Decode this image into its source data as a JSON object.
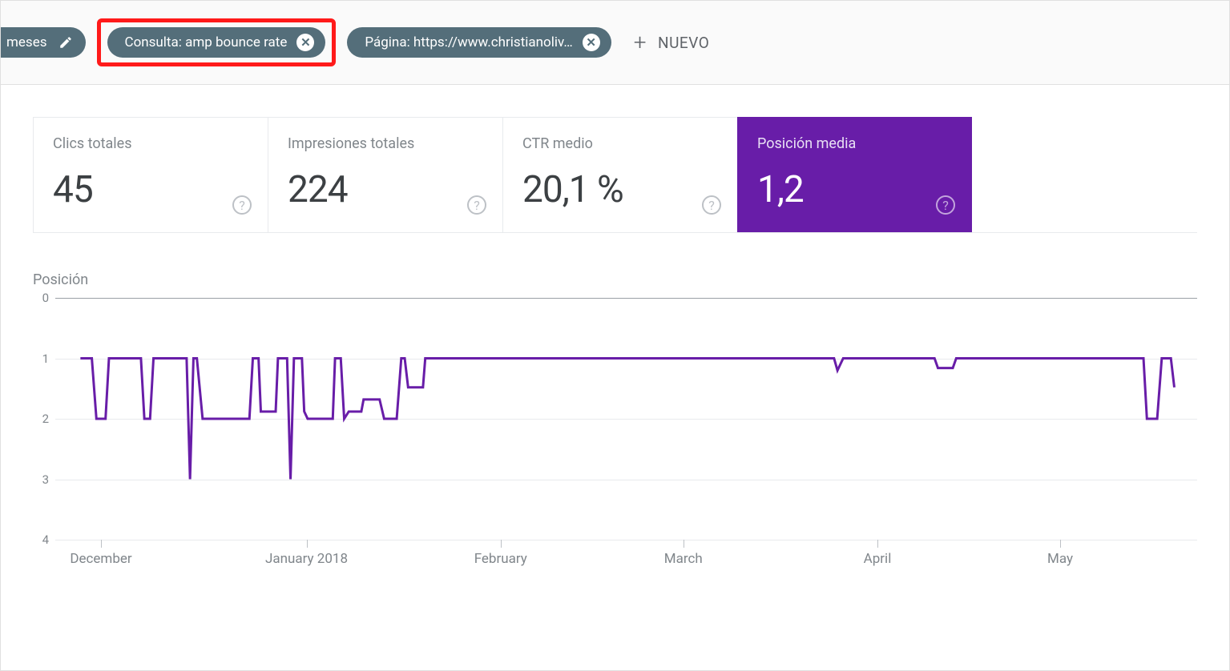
{
  "filters": {
    "date_chip": {
      "label": "meses",
      "icon": "edit"
    },
    "query_chip": {
      "label": "Consulta: amp bounce rate"
    },
    "page_chip": {
      "label": "Página: https://www.christianoliv…"
    },
    "new_label": "NUEVO"
  },
  "metrics": [
    {
      "label": "Clics totales",
      "value": "45",
      "active": false
    },
    {
      "label": "Impresiones totales",
      "value": "224",
      "active": false
    },
    {
      "label": "CTR medio",
      "value": "20,1 %",
      "active": false
    },
    {
      "label": "Posición media",
      "value": "1,2",
      "active": true
    }
  ],
  "chart_data": {
    "type": "line",
    "title": "Posición",
    "ylabel": "",
    "ylim": [
      4,
      0
    ],
    "yticks": [
      0,
      1,
      2,
      3,
      4
    ],
    "x_categories": [
      "December",
      "January 2018",
      "February",
      "March",
      "April",
      "May"
    ],
    "x_positions_pct": [
      4,
      22,
      39,
      55,
      72,
      88
    ],
    "series": [
      {
        "name": "Posición media",
        "points_pct": [
          [
            2.2,
            25
          ],
          [
            3.2,
            25
          ],
          [
            3.6,
            50
          ],
          [
            4.4,
            50
          ],
          [
            4.7,
            25
          ],
          [
            7.5,
            25
          ],
          [
            7.8,
            50
          ],
          [
            8.3,
            50
          ],
          [
            8.6,
            25
          ],
          [
            11.5,
            25
          ],
          [
            11.8,
            75
          ],
          [
            12.1,
            25
          ],
          [
            12.4,
            25
          ],
          [
            12.9,
            50
          ],
          [
            17.0,
            50
          ],
          [
            17.3,
            25
          ],
          [
            17.8,
            25
          ],
          [
            18.0,
            47
          ],
          [
            19.3,
            47
          ],
          [
            19.5,
            25
          ],
          [
            20.3,
            25
          ],
          [
            20.6,
            75
          ],
          [
            20.9,
            25
          ],
          [
            21.6,
            25
          ],
          [
            21.8,
            47
          ],
          [
            22.1,
            50
          ],
          [
            24.3,
            50
          ],
          [
            24.5,
            25
          ],
          [
            25.0,
            25
          ],
          [
            25.3,
            50
          ],
          [
            25.7,
            47
          ],
          [
            26.8,
            47
          ],
          [
            27.0,
            42
          ],
          [
            28.4,
            42
          ],
          [
            28.8,
            50
          ],
          [
            29.9,
            50
          ],
          [
            30.3,
            25
          ],
          [
            30.6,
            25
          ],
          [
            30.9,
            37
          ],
          [
            32.2,
            37
          ],
          [
            32.4,
            25
          ],
          [
            68.2,
            25
          ],
          [
            68.5,
            30
          ],
          [
            69.0,
            25
          ],
          [
            77.0,
            25
          ],
          [
            77.3,
            29
          ],
          [
            78.6,
            29
          ],
          [
            78.9,
            25
          ],
          [
            95.3,
            25
          ],
          [
            95.6,
            50
          ],
          [
            96.5,
            50
          ],
          [
            96.9,
            25
          ],
          [
            97.7,
            25
          ],
          [
            98.0,
            37
          ]
        ]
      }
    ]
  }
}
